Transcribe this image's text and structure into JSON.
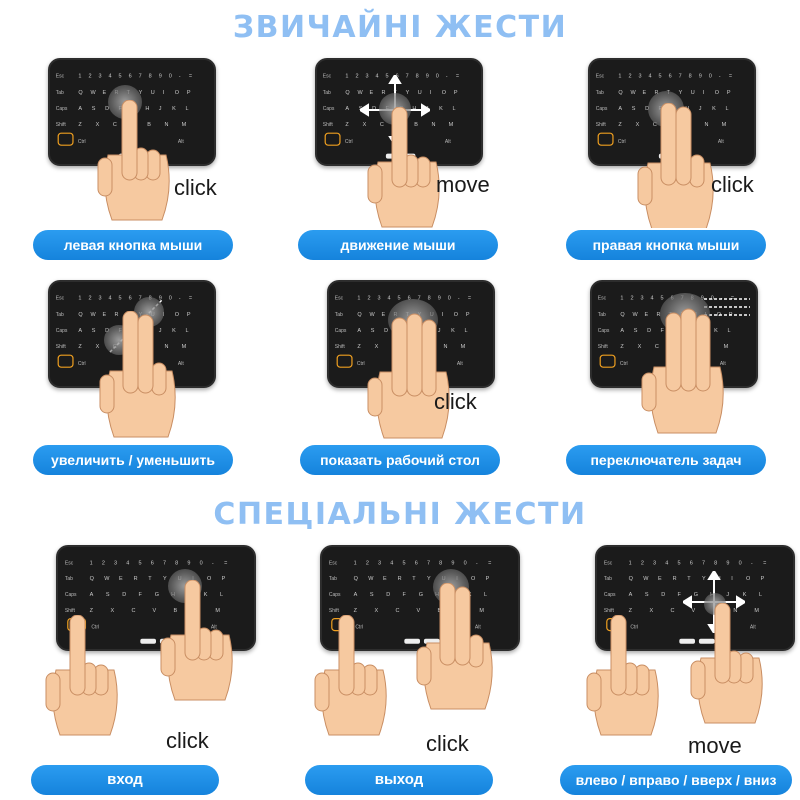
{
  "headings": {
    "regular": "ЗВИЧАЙНІ ЖЕСТИ",
    "special": "СПЕЦІАЛЬНІ ЖЕСТИ"
  },
  "keyboard": {
    "row_esc": "Esc",
    "row_tab": "Tab",
    "row_caps": "Caps",
    "row_shift": "Shift",
    "row_ctrl": "Ctrl",
    "row_alt": "Alt",
    "letters_row1": [
      "Q",
      "W",
      "E",
      "R",
      "T",
      "Y",
      "U",
      "I",
      "O",
      "P"
    ],
    "letters_row2": [
      "A",
      "S",
      "D",
      "F",
      "G",
      "H",
      "J",
      "K",
      "L"
    ],
    "letters_row3": [
      "Z",
      "X",
      "C",
      "V",
      "B",
      "N",
      "M"
    ]
  },
  "gestures": [
    {
      "word": "click",
      "label": "левая кнопка мыши"
    },
    {
      "word": "move",
      "label": "движение мыши"
    },
    {
      "word": "click",
      "label": "правая кнопка мыши"
    },
    {
      "word": "",
      "label": "увеличить / уменьшить"
    },
    {
      "word": "click",
      "label": "показать рабочий стол"
    },
    {
      "word": "",
      "label": "переключатель задач"
    },
    {
      "word": "click",
      "label": "вход"
    },
    {
      "word": "click",
      "label": "выход"
    },
    {
      "word": "move",
      "label": "влево / вправо / вверх / вниз"
    }
  ],
  "colors": {
    "heading": "#8fbff3",
    "pill": "#1c8fe6",
    "keyboard_body": "#1b1b1b",
    "skin": "#f6c9a0",
    "accent_key": "#f0a020"
  }
}
